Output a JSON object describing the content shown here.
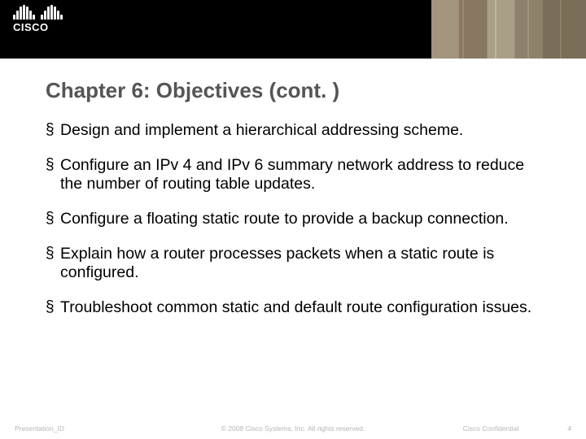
{
  "logo": {
    "word": "CISCO"
  },
  "title": "Chapter 6: Objectives (cont. )",
  "bullets": [
    "Design and implement a hierarchical addressing scheme.",
    "Configure an IPv 4 and IPv 6 summary network address to reduce the number of routing table updates.",
    "Configure a floating static route to provide a backup connection.",
    "Explain how a router processes packets when a static route is configured.",
    "Troubleshoot common static and default route configuration issues."
  ],
  "footer": {
    "left": "Presentation_ID",
    "center": "© 2008 Cisco Systems, Inc. All rights reserved.",
    "confidential": "Cisco Confidential",
    "page": "4"
  }
}
